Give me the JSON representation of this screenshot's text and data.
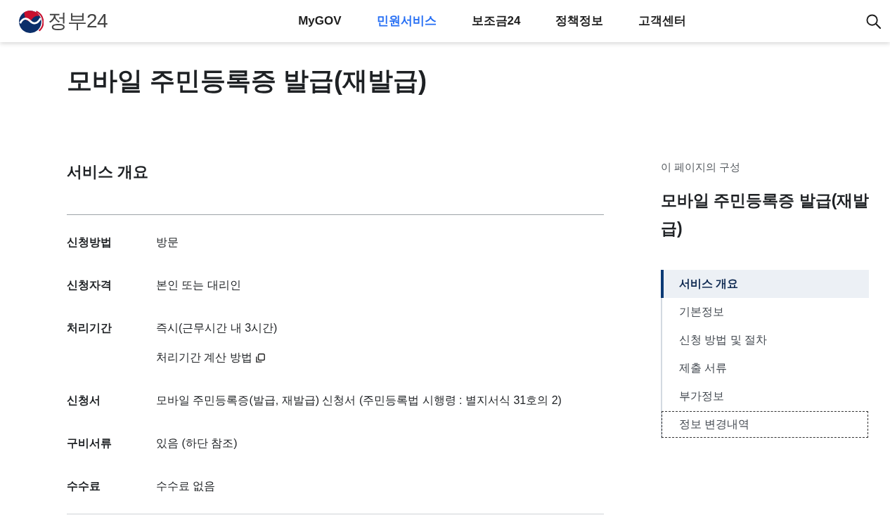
{
  "header": {
    "logo_text": "정부24",
    "nav": [
      {
        "label": "MyGOV",
        "selected": false
      },
      {
        "label": "민원서비스",
        "selected": true
      },
      {
        "label": "보조금24",
        "selected": false
      },
      {
        "label": "정책정보",
        "selected": false
      },
      {
        "label": "고객센터",
        "selected": false
      }
    ]
  },
  "page_title": "모바일 주민등록증 발급(재발급)",
  "overview": {
    "title": "서비스 개요",
    "rows": [
      {
        "label": "신청방법",
        "lines": [
          {
            "kind": "text",
            "text": "방문"
          }
        ]
      },
      {
        "label": "신청자격",
        "lines": [
          {
            "kind": "text",
            "text": "본인 또는 대리인"
          }
        ]
      },
      {
        "label": "처리기간",
        "lines": [
          {
            "kind": "text",
            "text": "즉시(근무시간 내 3시간)"
          },
          {
            "kind": "link",
            "text": "처리기간 계산 방법"
          }
        ]
      },
      {
        "label": "신청서",
        "lines": [
          {
            "kind": "text",
            "text": "모바일 주민등록증(발급, 재발급) 신청서 (주민등록법 시행령 : 별지서식 31호의 2)"
          }
        ]
      },
      {
        "label": "구비서류",
        "lines": [
          {
            "kind": "text",
            "text": "있음 (하단 참조)"
          }
        ]
      },
      {
        "label": "수수료",
        "lines": [
          {
            "kind": "text",
            "text": "수수료 없음"
          }
        ]
      }
    ]
  },
  "page_contents": {
    "caption": "이 페이지의 구성",
    "title": "모바일 주민등록증 발급(재발급)",
    "items": [
      {
        "label": "서비스 개요",
        "selected": true,
        "focused": false
      },
      {
        "label": "기본정보",
        "selected": false,
        "focused": false
      },
      {
        "label": "신청 방법 및 절차",
        "selected": false,
        "focused": false
      },
      {
        "label": "제출 서류",
        "selected": false,
        "focused": false
      },
      {
        "label": "부가정보",
        "selected": false,
        "focused": false
      },
      {
        "label": "정보 변경내역",
        "selected": false,
        "focused": true
      }
    ]
  }
}
